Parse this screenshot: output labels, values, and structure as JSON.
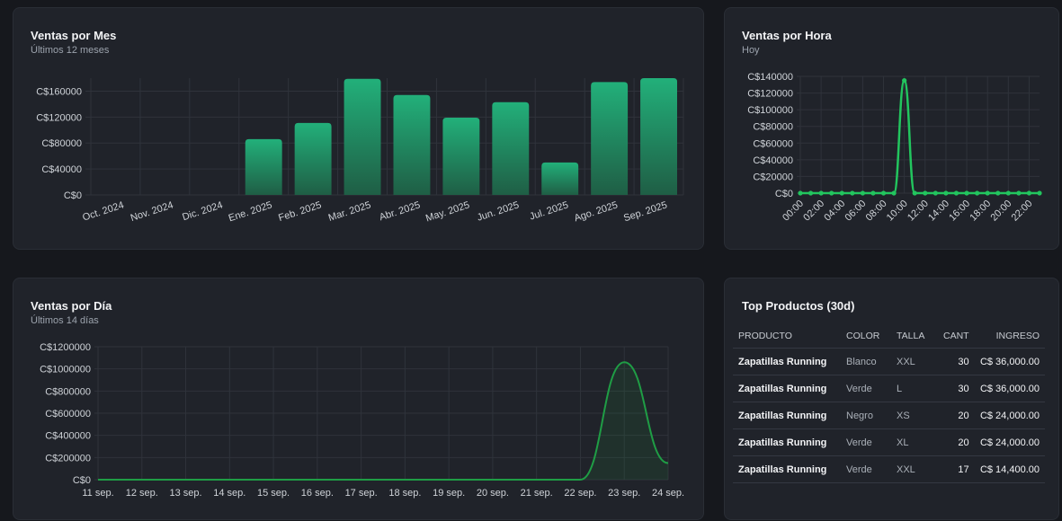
{
  "colors": {
    "accent": "#22c55e",
    "bar_top": "#22b07a",
    "bar_bottom": "#1f5e45",
    "line": "#22c55e",
    "line2": "#1f9d45"
  },
  "monthly": {
    "title": "Ventas por Mes",
    "subtitle": "Últimos 12 meses"
  },
  "hourly": {
    "title": "Ventas por Hora",
    "subtitle": "Hoy"
  },
  "daily": {
    "title": "Ventas por Día",
    "subtitle": "Últimos 14 días"
  },
  "top_products": {
    "title": "Top Productos (30d)",
    "columns": [
      "PRODUCTO",
      "COLOR",
      "TALLA",
      "CANT",
      "INGRESO"
    ],
    "rows": [
      [
        "Zapatillas Running",
        "Blanco",
        "XXL",
        "30",
        "C$ 36,000.00"
      ],
      [
        "Zapatillas Running",
        "Verde",
        "L",
        "30",
        "C$ 36,000.00"
      ],
      [
        "Zapatillas Running",
        "Negro",
        "XS",
        "20",
        "C$ 24,000.00"
      ],
      [
        "Zapatillas Running",
        "Verde",
        "XL",
        "20",
        "C$ 24,000.00"
      ],
      [
        "Zapatillas Running",
        "Verde",
        "XXL",
        "17",
        "C$ 14,400.00"
      ]
    ]
  },
  "chart_data": [
    {
      "type": "bar",
      "title": "Ventas por Mes",
      "subtitle": "Últimos 12 meses",
      "categories": [
        "Oct. 2024",
        "Nov. 2024",
        "Dic. 2024",
        "Ene. 2025",
        "Feb. 2025",
        "Mar. 2025",
        "Abr. 2025",
        "May. 2025",
        "Jun. 2025",
        "Jul. 2025",
        "Ago. 2025",
        "Sep. 2025"
      ],
      "values": [
        0,
        0,
        0,
        86000,
        111000,
        179000,
        154000,
        119000,
        143000,
        50000,
        174000,
        180000
      ],
      "yticks": [
        "C$0",
        "C$40000",
        "C$80000",
        "C$120000",
        "C$160000"
      ],
      "ylim": [
        0,
        180000
      ],
      "grid": true
    },
    {
      "type": "line",
      "title": "Ventas por Hora",
      "subtitle": "Hoy",
      "x": [
        "00:00",
        "01:00",
        "02:00",
        "03:00",
        "04:00",
        "05:00",
        "06:00",
        "07:00",
        "08:00",
        "09:00",
        "10:00",
        "11:00",
        "12:00",
        "13:00",
        "14:00",
        "15:00",
        "16:00",
        "17:00",
        "18:00",
        "19:00",
        "20:00",
        "21:00",
        "22:00",
        "23:00"
      ],
      "xticks": [
        "00:00",
        "02:00",
        "04:00",
        "06:00",
        "08:00",
        "10:00",
        "12:00",
        "14:00",
        "16:00",
        "18:00",
        "20:00",
        "22:00"
      ],
      "values": [
        0,
        0,
        0,
        0,
        0,
        0,
        0,
        0,
        0,
        0,
        135000,
        0,
        0,
        0,
        0,
        0,
        0,
        0,
        0,
        0,
        0,
        0,
        0,
        0
      ],
      "yticks": [
        "C$0",
        "C$20000",
        "C$40000",
        "C$60000",
        "C$80000",
        "C$100000",
        "C$120000",
        "C$140000"
      ],
      "ylim": [
        0,
        140000
      ],
      "grid": true
    },
    {
      "type": "area",
      "title": "Ventas por Día",
      "subtitle": "Últimos 14 días",
      "x": [
        "11 sep.",
        "12 sep.",
        "13 sep.",
        "14 sep.",
        "15 sep.",
        "16 sep.",
        "17 sep.",
        "18 sep.",
        "19 sep.",
        "20 sep.",
        "21 sep.",
        "22 sep.",
        "23 sep.",
        "24 sep."
      ],
      "values": [
        0,
        0,
        0,
        0,
        0,
        0,
        0,
        0,
        0,
        0,
        0,
        0,
        1060000,
        150000
      ],
      "yticks": [
        "C$0",
        "C$200000",
        "C$400000",
        "C$600000",
        "C$800000",
        "C$1000000",
        "C$1200000"
      ],
      "ylim": [
        0,
        1200000
      ],
      "grid": true
    }
  ]
}
